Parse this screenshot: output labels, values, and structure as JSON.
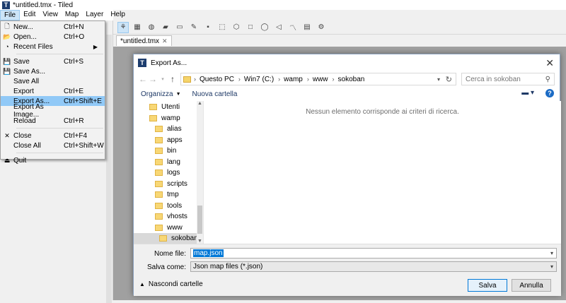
{
  "window": {
    "title": "*untitled.tmx - Tiled",
    "app_icon": "T"
  },
  "menubar": [
    "File",
    "Edit",
    "View",
    "Map",
    "Layer",
    "Help"
  ],
  "doc_tab": {
    "label": "*untitled.tmx",
    "close": "✕"
  },
  "file_menu": [
    {
      "icon": "new-file-icon",
      "glyph": "🗋",
      "label": "New...",
      "shortcut": "Ctrl+N"
    },
    {
      "icon": "open-folder-icon",
      "glyph": "📂",
      "label": "Open...",
      "shortcut": "Ctrl+O"
    },
    {
      "icon": "recent-files-icon",
      "glyph": "◔",
      "label": "Recent Files",
      "shortcut": "",
      "submenu": "▶"
    },
    {
      "sep": true
    },
    {
      "icon": "save-icon",
      "glyph": "💾",
      "label": "Save",
      "shortcut": "Ctrl+S"
    },
    {
      "icon": "save-as-icon",
      "glyph": "💾",
      "label": "Save As...",
      "shortcut": ""
    },
    {
      "icon": "",
      "glyph": "",
      "label": "Save All",
      "shortcut": ""
    },
    {
      "icon": "",
      "glyph": "",
      "label": "Export",
      "shortcut": "Ctrl+E"
    },
    {
      "icon": "",
      "glyph": "",
      "label": "Export As...",
      "shortcut": "Ctrl+Shift+E",
      "highlight": true
    },
    {
      "icon": "",
      "glyph": "",
      "label": "Export As Image...",
      "shortcut": ""
    },
    {
      "icon": "",
      "glyph": "",
      "label": "Reload",
      "shortcut": "Ctrl+R"
    },
    {
      "sep": true
    },
    {
      "icon": "close-icon",
      "glyph": "✕",
      "label": "Close",
      "shortcut": "Ctrl+F4"
    },
    {
      "icon": "",
      "glyph": "",
      "label": "Close All",
      "shortcut": "Ctrl+Shift+W"
    },
    {
      "sep": true
    },
    {
      "icon": "quit-icon",
      "glyph": "⏏",
      "label": "Quit",
      "shortcut": ""
    }
  ],
  "dialog": {
    "title": "Export As...",
    "close": "✕",
    "breadcrumbs": [
      "Questo PC",
      "Win7 (C:)",
      "wamp",
      "www",
      "sokoban"
    ],
    "search_placeholder": "Cerca in sokoban",
    "organize": "Organizza",
    "new_folder": "Nuova cartella",
    "help": "?",
    "tree": [
      "Utenti",
      "wamp",
      "alias",
      "apps",
      "bin",
      "lang",
      "logs",
      "scripts",
      "tmp",
      "tools",
      "vhosts",
      "www",
      "sokoban"
    ],
    "selected_tree_item": "sokoban",
    "empty_message": "Nessun elemento corrisponde ai criteri di ricerca.",
    "filename_label": "Nome file:",
    "filename_value": "map.json",
    "savetype_label": "Salva come:",
    "savetype_value": "Json map files (*.json)",
    "hide_folders": "Nascondi cartelle",
    "save_button": "Salva",
    "cancel_button": "Annulla"
  }
}
